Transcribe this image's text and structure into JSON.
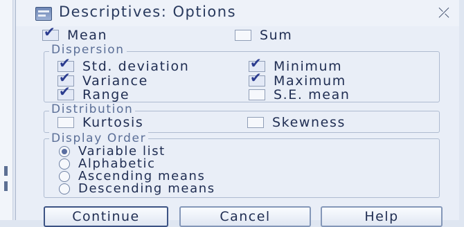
{
  "dialog": {
    "title": "Descriptives: Options",
    "close_glyph": "⤫",
    "icon": "descriptives-app-icon"
  },
  "top_options": [
    {
      "label": "Mean",
      "checked": true
    },
    {
      "label": "Sum",
      "checked": false
    }
  ],
  "dispersion": {
    "title": "Dispersion",
    "items": [
      {
        "label": "Std. deviation",
        "checked": true
      },
      {
        "label": "Minimum",
        "checked": true
      },
      {
        "label": "Variance",
        "checked": true
      },
      {
        "label": "Maximum",
        "checked": true
      },
      {
        "label": "Range",
        "checked": true
      },
      {
        "label": "S.E. mean",
        "checked": false
      }
    ]
  },
  "distribution": {
    "title": "Distribution",
    "items": [
      {
        "label": "Kurtosis",
        "checked": false
      },
      {
        "label": "Skewness",
        "checked": false
      }
    ]
  },
  "display_order": {
    "title": "Display Order",
    "options": [
      {
        "label": "Variable list",
        "selected": true
      },
      {
        "label": "Alphabetic",
        "selected": false
      },
      {
        "label": "Ascending means",
        "selected": false
      },
      {
        "label": "Descending means",
        "selected": false
      }
    ]
  },
  "buttons": {
    "continue": "Continue",
    "cancel": "Cancel",
    "help": "Help"
  },
  "colors": {
    "dialog_bg": "#e9eef7",
    "check": "#2b3c8f",
    "group_title": "#5b6f97"
  }
}
